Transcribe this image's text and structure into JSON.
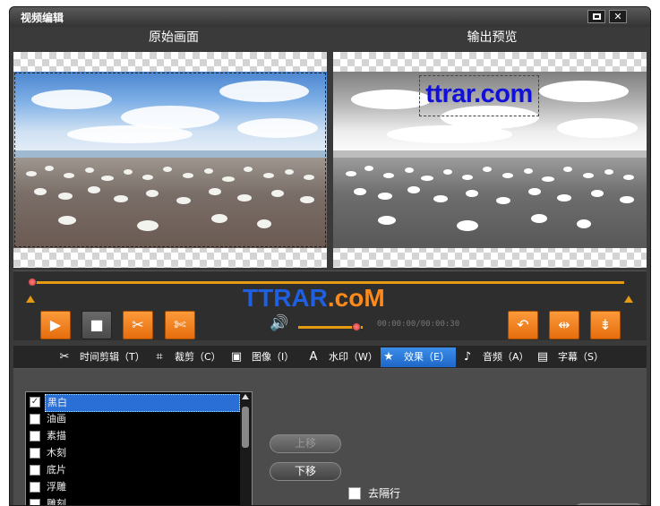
{
  "window": {
    "title": "视频编辑"
  },
  "labels": {
    "original": "原始画面",
    "preview": "输出预览"
  },
  "watermark": {
    "text": "ttrar.com",
    "color": "#1010d8"
  },
  "logo": {
    "part1": "TTRAR",
    "part2": ".coM",
    "color1": "#1f5fe0",
    "color2": "#ff8a1a"
  },
  "player": {
    "time": "00:00:00/00:00:30",
    "timeline_progress": 0.0,
    "volume_level": 0.9,
    "accent_color": "#e59a14"
  },
  "tabs": [
    {
      "label": "时间剪辑（T）",
      "icon": "scissors-icon"
    },
    {
      "label": "裁剪（C）",
      "icon": "crop-icon"
    },
    {
      "label": "图像（I）",
      "icon": "image-icon"
    },
    {
      "label": "水印（W）",
      "icon": "watermark-icon"
    },
    {
      "label": "效果（E）",
      "icon": "star-icon",
      "active": true
    },
    {
      "label": "音频（A）",
      "icon": "music-note-icon"
    },
    {
      "label": "字幕（S）",
      "icon": "subtitle-icon"
    }
  ],
  "effects": [
    {
      "label": "黑白",
      "checked": true,
      "selected": true
    },
    {
      "label": "油画",
      "checked": false
    },
    {
      "label": "素描",
      "checked": false
    },
    {
      "label": "木刻",
      "checked": false
    },
    {
      "label": "底片",
      "checked": false
    },
    {
      "label": "浮雕",
      "checked": false
    },
    {
      "label": "雕刻",
      "checked": false
    }
  ],
  "buttons": {
    "move_up": "上移",
    "move_down": "下移"
  },
  "deinterlace": {
    "label": "去隔行",
    "checked": false
  }
}
